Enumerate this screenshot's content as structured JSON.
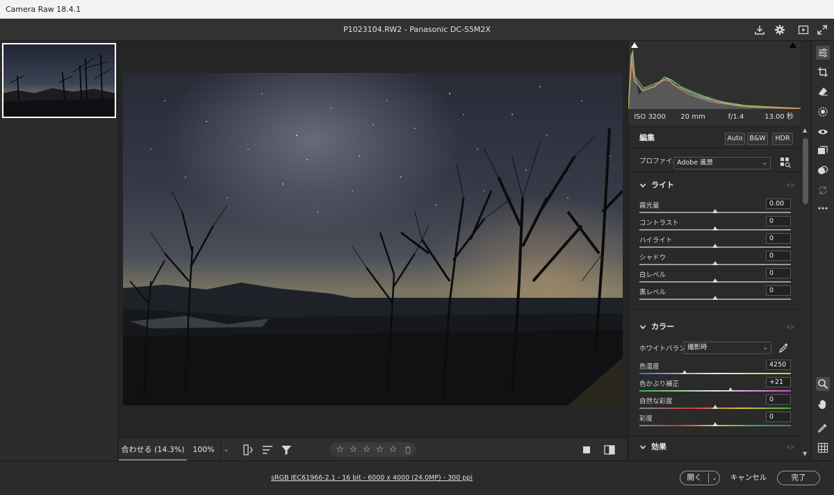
{
  "window": {
    "title": "Camera Raw 18.4.1"
  },
  "header": {
    "file_title": "P1023104.RW2  -  Panasonic DC-S5M2X",
    "icons": [
      "save-icon",
      "gear-icon",
      "slideshow-icon",
      "fullscreen-icon"
    ]
  },
  "histogram": {
    "iso": "ISO 3200",
    "focal": "20 mm",
    "aperture": "f/1.4",
    "shutter": "13.00 秒"
  },
  "edit": {
    "label": "編集",
    "auto": "Auto",
    "bw": "B&W",
    "hdr": "HDR"
  },
  "profile": {
    "label": "プロファイル",
    "value": "Adobe 風景"
  },
  "light": {
    "title": "ライト",
    "sliders": [
      {
        "name": "露光量",
        "value": "0.00",
        "position": 0.5
      },
      {
        "name": "コントラスト",
        "value": "0",
        "position": 0.5
      },
      {
        "name": "ハイライト",
        "value": "0",
        "position": 0.5
      },
      {
        "name": "シャドウ",
        "value": "0",
        "position": 0.5
      },
      {
        "name": "白レベル",
        "value": "0",
        "position": 0.5
      },
      {
        "name": "黒レベル",
        "value": "0",
        "position": 0.5
      }
    ]
  },
  "color": {
    "title": "カラー",
    "wb_label": "ホワイトバランス",
    "wb_value": "撮影時",
    "sliders": [
      {
        "name": "色温度",
        "value": "4250",
        "position": 0.3
      },
      {
        "name": "色かぶり補正",
        "value": "+21",
        "position": 0.6
      },
      {
        "name": "自然な彩度",
        "value": "0",
        "position": 0.5
      },
      {
        "name": "彩度",
        "value": "0",
        "position": 0.5
      }
    ]
  },
  "effects": {
    "title": "効果"
  },
  "canvas_toolbar": {
    "fit": "合わせる (14.3%)",
    "zoom": "100%",
    "rating": 0
  },
  "status": {
    "info": "sRGB IEC61966-2.1 - 16 bit - 6000 x 4000 (24.0MP) - 300 ppi",
    "open": "開く",
    "cancel": "キャンセル",
    "done": "完了"
  },
  "rail_icons": [
    "edit-sliders-icon",
    "crop-icon",
    "eraser-icon",
    "mask-icon",
    "redeye-icon",
    "snapshots-icon",
    "presets-icon",
    "sync-icon",
    "more-icon",
    "zoom-icon",
    "hand-icon",
    "sampler-icon",
    "grid-icon"
  ]
}
